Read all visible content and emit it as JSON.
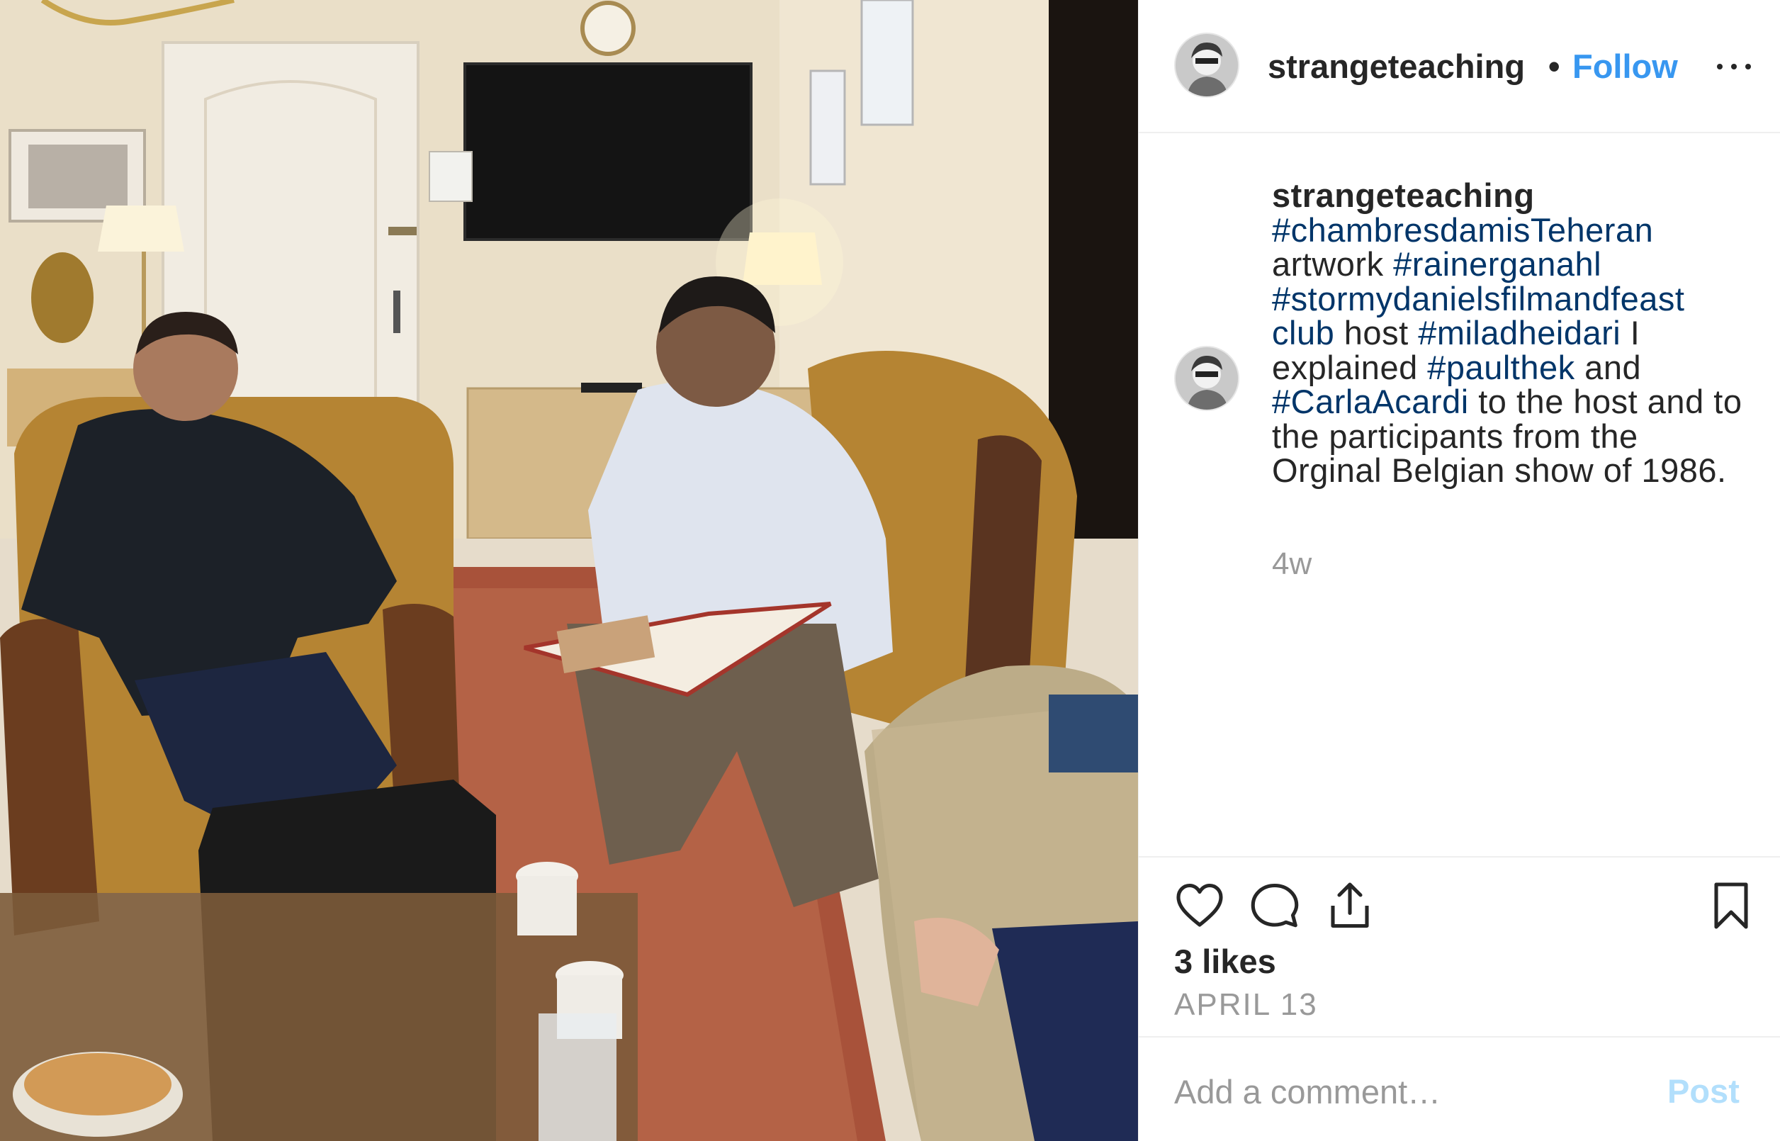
{
  "post": {
    "author": "strangeteaching",
    "follow_label": "Follow",
    "dot": "•",
    "more_icon": "more-options-icon"
  },
  "caption": {
    "username": "strangeteaching",
    "segments": [
      {
        "text": "#chambresdamisTeheran",
        "tag": true
      },
      {
        "text": " artwork ",
        "tag": false
      },
      {
        "text": "#rainerganahl",
        "tag": true
      },
      {
        "text": " ",
        "tag": false
      },
      {
        "text": "#stormydanielsfilmandfeast club",
        "tag": true
      },
      {
        "text": " host ",
        "tag": false
      },
      {
        "text": "#miladheidari",
        "tag": true
      },
      {
        "text": " I explained ",
        "tag": false
      },
      {
        "text": "#paulthek",
        "tag": true
      },
      {
        "text": " and ",
        "tag": false
      },
      {
        "text": "#CarlaAcardi",
        "tag": true
      },
      {
        "text": " to the host and to the participants from the Orginal Belgian show of 1986.",
        "tag": false
      }
    ],
    "relative_time": "4w"
  },
  "actions": {
    "like_icon": "heart-icon",
    "comment_icon": "comment-icon",
    "share_icon": "share-icon",
    "save_icon": "bookmark-icon"
  },
  "likes_text": "3 likes",
  "date_text": "APRIL 13",
  "comment": {
    "placeholder": "Add a comment…",
    "post_label": "Post"
  },
  "colors": {
    "link_blue": "#3897f0",
    "hashtag": "#003569",
    "muted": "#999999",
    "post_disabled": "#b2dffc"
  }
}
